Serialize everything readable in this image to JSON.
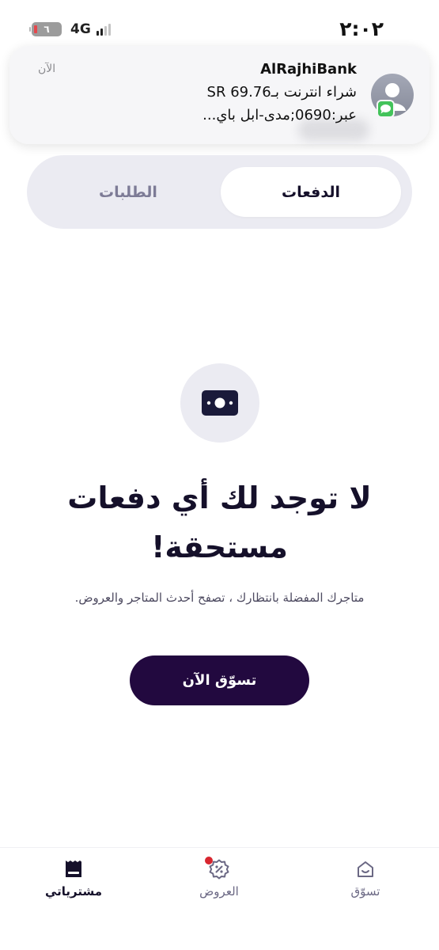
{
  "status_bar": {
    "time": "٢:٠٢",
    "network": "4G",
    "battery_level": "٦",
    "colors": {
      "battery_low": "#e5484d"
    }
  },
  "notification": {
    "app_name": "AlRajhiBank",
    "time": "الآن",
    "line1": "شراء انترنت بـ69.76 SR",
    "line2": "عبر:0690;مدى-ابل باي...",
    "icons": {
      "avatar": "person-avatar-icon",
      "badge": "messages-app-icon"
    }
  },
  "tabs": {
    "payments": "الدفعات",
    "orders": "الطلبات"
  },
  "empty_state": {
    "icon": "cash-icon",
    "title": "لا توجد لك أي دفعات مستحقة!",
    "subtitle": "متاجرك المفضلة بانتظارك ، تصفح أحدث المتاجر والعروض.",
    "button_label": "تسوّق الآن"
  },
  "bottom_nav": {
    "purchases": "مشترياتي",
    "offers": "العروض",
    "shop": "تسوّق",
    "active": "purchases",
    "offers_has_dot": true
  },
  "colors": {
    "primary": "#22093f",
    "text_dark": "#15102a",
    "tab_track": "#ebebf2",
    "muted": "#7d7b96",
    "notification_dot": "#d8262f"
  }
}
